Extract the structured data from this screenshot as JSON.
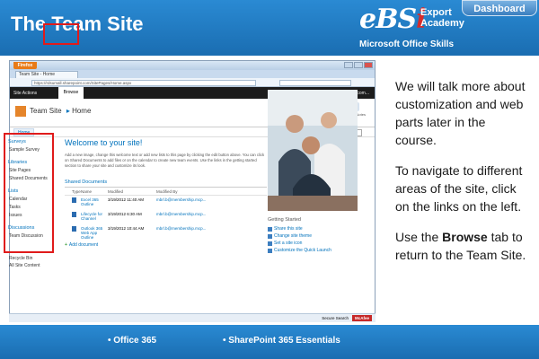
{
  "slide": {
    "title": "The Team Site",
    "dashboard_label": "Dashboard",
    "logo_text": "eBSi",
    "logo_sub_1": "Export",
    "logo_sub_2": "Academy",
    "skills_label": "Microsoft Office Skills",
    "footer_items": [
      "• Office 365",
      "• SharePoint 365 Essentials"
    ]
  },
  "notes": {
    "p1": "We will talk more about customization and web parts later in the course.",
    "p2": "To navigate to different areas of the site, click on the links on the left.",
    "p3_before": "Use the ",
    "p3_bold": "Browse",
    "p3_after": " tab to return to the Team Site."
  },
  "browser": {
    "firefox_label": "Firefox",
    "tab_title": "Team Site - Home",
    "url": "https://rdsumall.sharepoint.com/SitePages/Home.aspx",
    "status_search": "Secure Search",
    "status_mcafee": "McAfee"
  },
  "sharepoint": {
    "site_actions": "Site Actions",
    "browse_tab": "Browse",
    "user": "mbrl.b@membership.com...",
    "site_title": "Team Site",
    "site_title_suffix": "Home",
    "home_tab": "Home",
    "search_placeholder": "Search this site...",
    "header_icons": [
      "I Like It",
      "Tags & Notes"
    ],
    "quicklaunch": {
      "sections": [
        {
          "heading": "Surveys",
          "items": [
            "Sample Survey"
          ]
        },
        {
          "heading": "Libraries",
          "items": [
            "Site Pages",
            "Shared Documents"
          ]
        },
        {
          "heading": "Lists",
          "items": [
            "Calendar",
            "Tasks",
            "Issues"
          ]
        },
        {
          "heading": "Discussions",
          "items": [
            "Team Discussion"
          ]
        }
      ],
      "extra": [
        "Recycle Bin",
        "All Site Content"
      ]
    },
    "welcome_title": "Welcome to your site!",
    "welcome_text": "Add a new image, change this welcome text or add new lists to this page by clicking the edit button above. You can click on Shared Documents to add files or on the calendar to create new team events. Use the links in the getting started section to share your site and customize its look.",
    "shared_docs_title": "Shared Documents",
    "doc_columns": [
      "Type",
      "Name",
      "Modified",
      "Modified By"
    ],
    "docs": [
      {
        "name": "Excel 365 Outline",
        "modified": "3/19/2012 11:40 AM",
        "by": "mbrl.b@membership.mcp..."
      },
      {
        "name": "Lifecycle for Channel",
        "modified": "3/19/2012 6:30 AM",
        "by": "mbrl.b@membership.mcp..."
      },
      {
        "name": "Outlook 365 Web App Outline",
        "modified": "3/19/2012 10:44 AM",
        "by": "mbrl.b@membership.mcp..."
      }
    ],
    "add_document": "Add document",
    "getting_started_title": "Getting Started",
    "getting_started_items": [
      "Share this site",
      "Change site theme",
      "Set a site icon",
      "Customize the Quick Launch"
    ]
  }
}
